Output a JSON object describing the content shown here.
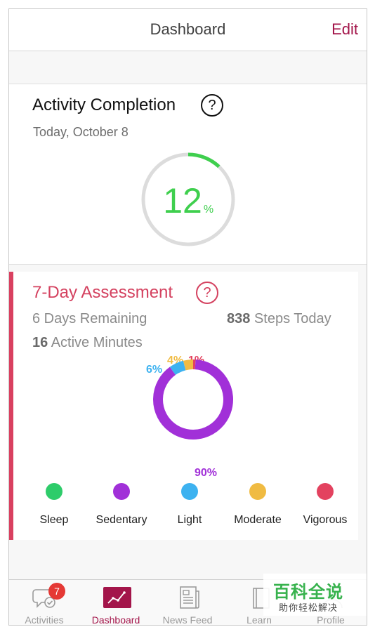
{
  "header": {
    "title": "Dashboard",
    "edit_label": "Edit"
  },
  "activity": {
    "title": "Activity Completion",
    "help": "?",
    "date": "Today, October 8",
    "percent_value": "12",
    "percent_sign": "%",
    "progress": 0.12,
    "accent_color": "#3fcf4e"
  },
  "assessment": {
    "title": "7-Day Assessment",
    "help": "?",
    "days_remaining": "6 Days Remaining",
    "steps_value": "838",
    "steps_label": "Steps Today",
    "minutes_value": "16",
    "minutes_label": "Active Minutes",
    "breakdown": [
      {
        "label": "Sedentary",
        "percent": 90,
        "text": "90%",
        "color": "#a130d8"
      },
      {
        "label": "Light",
        "percent": 6,
        "text": "6%",
        "color": "#3db2f0"
      },
      {
        "label": "Moderate",
        "percent": 4,
        "text": "4%",
        "color": "#f0bb42"
      },
      {
        "label": "Vigorous",
        "percent": 1,
        "text": "1%",
        "color": "#e3425f"
      }
    ],
    "legend": [
      {
        "label": "Sleep",
        "color": "#2ecc6a"
      },
      {
        "label": "Sedentary",
        "color": "#a130d8"
      },
      {
        "label": "Light",
        "color": "#3db2f0"
      },
      {
        "label": "Moderate",
        "color": "#f0bb42"
      },
      {
        "label": "Vigorous",
        "color": "#e3425f"
      }
    ]
  },
  "tabs": [
    {
      "label": "Activities",
      "icon": "chat-check-icon",
      "badge": "7",
      "active": false
    },
    {
      "label": "Dashboard",
      "icon": "chart-line-icon",
      "active": true
    },
    {
      "label": "News Feed",
      "icon": "newspaper-icon",
      "active": false
    },
    {
      "label": "Learn",
      "icon": "book-icon",
      "active": false
    },
    {
      "label": "Profile",
      "icon": "person-icon",
      "active": false
    }
  ],
  "watermark": {
    "main": "百科全说",
    "sub": "助你轻松解决"
  }
}
